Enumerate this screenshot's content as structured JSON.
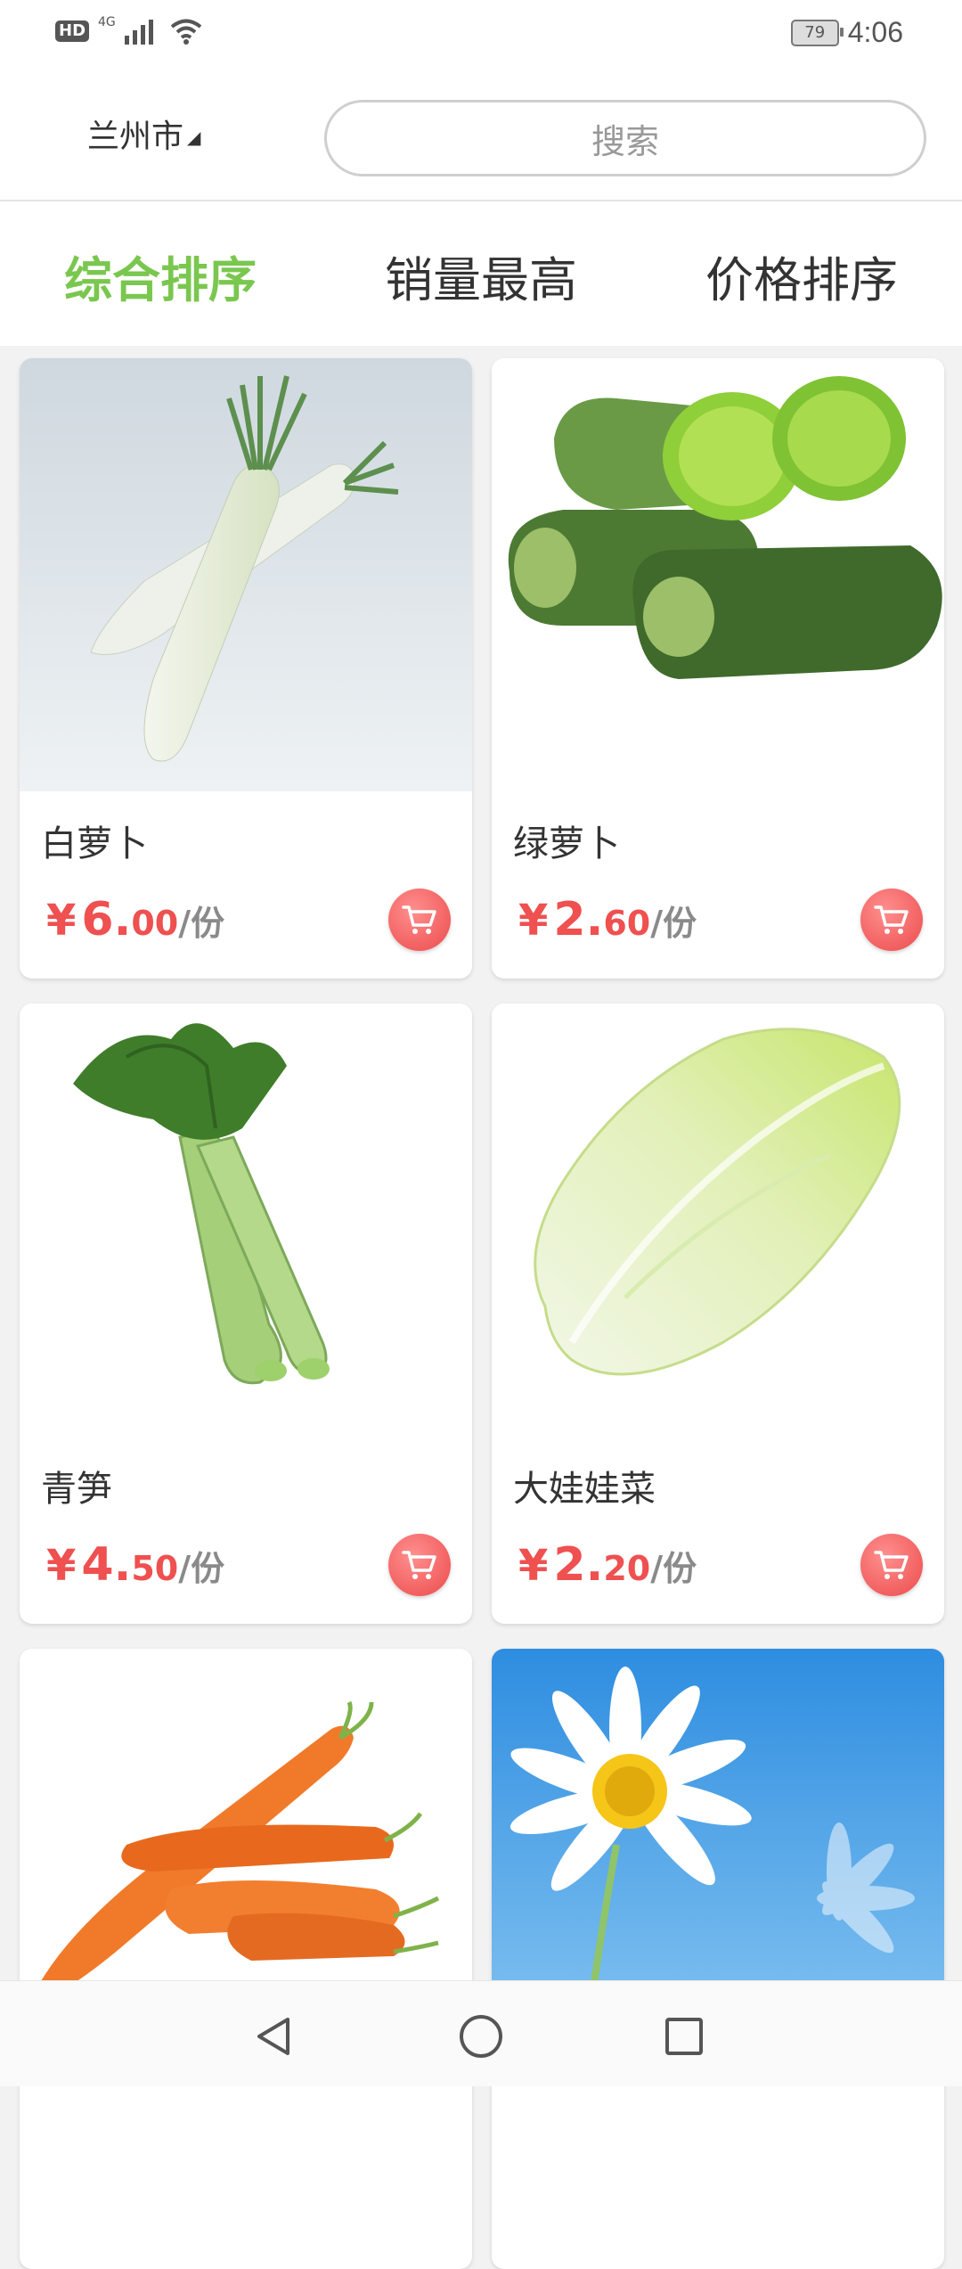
{
  "status_bar": {
    "hd": "HD",
    "network": "4G",
    "battery": "79",
    "time": "4:06"
  },
  "header": {
    "city": "兰州市",
    "search_placeholder": "搜索"
  },
  "sort_tabs": [
    {
      "label": "综合排序",
      "active": true
    },
    {
      "label": "销量最高",
      "active": false
    },
    {
      "label": "价格排序",
      "active": false
    }
  ],
  "products": [
    {
      "name": "白萝卜",
      "currency": "¥",
      "price_int": "6.",
      "price_dec": "00",
      "unit": "/份",
      "image": "white-radish"
    },
    {
      "name": "绿萝卜",
      "currency": "¥",
      "price_int": "2.",
      "price_dec": "60",
      "unit": "/份",
      "image": "green-radish"
    },
    {
      "name": "青笋",
      "currency": "¥",
      "price_int": "4.",
      "price_dec": "50",
      "unit": "/份",
      "image": "celtuce"
    },
    {
      "name": "大娃娃菜",
      "currency": "¥",
      "price_int": "2.",
      "price_dec": "20",
      "unit": "/份",
      "image": "baby-cabbage"
    },
    {
      "name": "",
      "image": "carrot"
    },
    {
      "name": "",
      "image": "daisy"
    }
  ],
  "colors": {
    "accent_green": "#7ac74f",
    "price_red": "#ef5050",
    "cart_red": "#ec4b4b"
  },
  "icons": [
    "signal-icon",
    "wifi-icon",
    "battery-icon",
    "caret-down-icon",
    "cart-icon",
    "back-icon",
    "home-icon",
    "recents-icon"
  ]
}
